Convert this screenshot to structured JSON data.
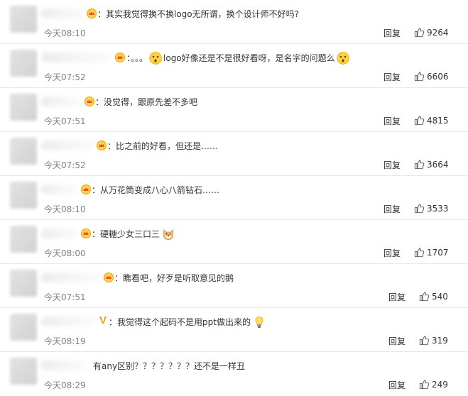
{
  "comments": [
    {
      "text": "：其实我觉得换不换logo无所谓，换个设计师不好吗?",
      "time": "今天08:10",
      "reply": "回复",
      "likes": "9264",
      "badge": "crown-icon"
    },
    {
      "text_a": "：。。。",
      "text_b": "logo好像还是不是很好看呀，是名字的问题么",
      "time": "今天07:52",
      "reply": "回复",
      "likes": "6606",
      "badge": "crown-icon"
    },
    {
      "text": "：没觉得，跟原先差不多吧",
      "time": "今天07:51",
      "reply": "回复",
      "likes": "4815",
      "badge": "crown-icon"
    },
    {
      "text": "：比之前的好看，但还是……",
      "time": "今天07:52",
      "reply": "回复",
      "likes": "3664",
      "badge": "crown-icon"
    },
    {
      "text": "：从万花筒变成八心八箭钻石……",
      "time": "今天08:10",
      "reply": "回复",
      "likes": "3533",
      "badge": "crown-icon"
    },
    {
      "text": "：硬糖少女三口三",
      "time": "今天08:00",
      "reply": "回复",
      "likes": "1707",
      "badge": "crown-icon"
    },
    {
      "text": "：瞧看吧，好歹是听取意见的鹅",
      "time": "今天07:51",
      "reply": "回复",
      "likes": "540",
      "badge": "crown-icon"
    },
    {
      "vip": "V",
      "text": "：我觉得这个起码不是用ppt做出来的",
      "time": "今天08:19",
      "reply": "回复",
      "likes": "319",
      "badge": "vip-icon"
    },
    {
      "text": "有any区别？？？？？？？还不是一样丑",
      "time": "今天08:29",
      "reply": "回复",
      "likes": "249"
    }
  ]
}
